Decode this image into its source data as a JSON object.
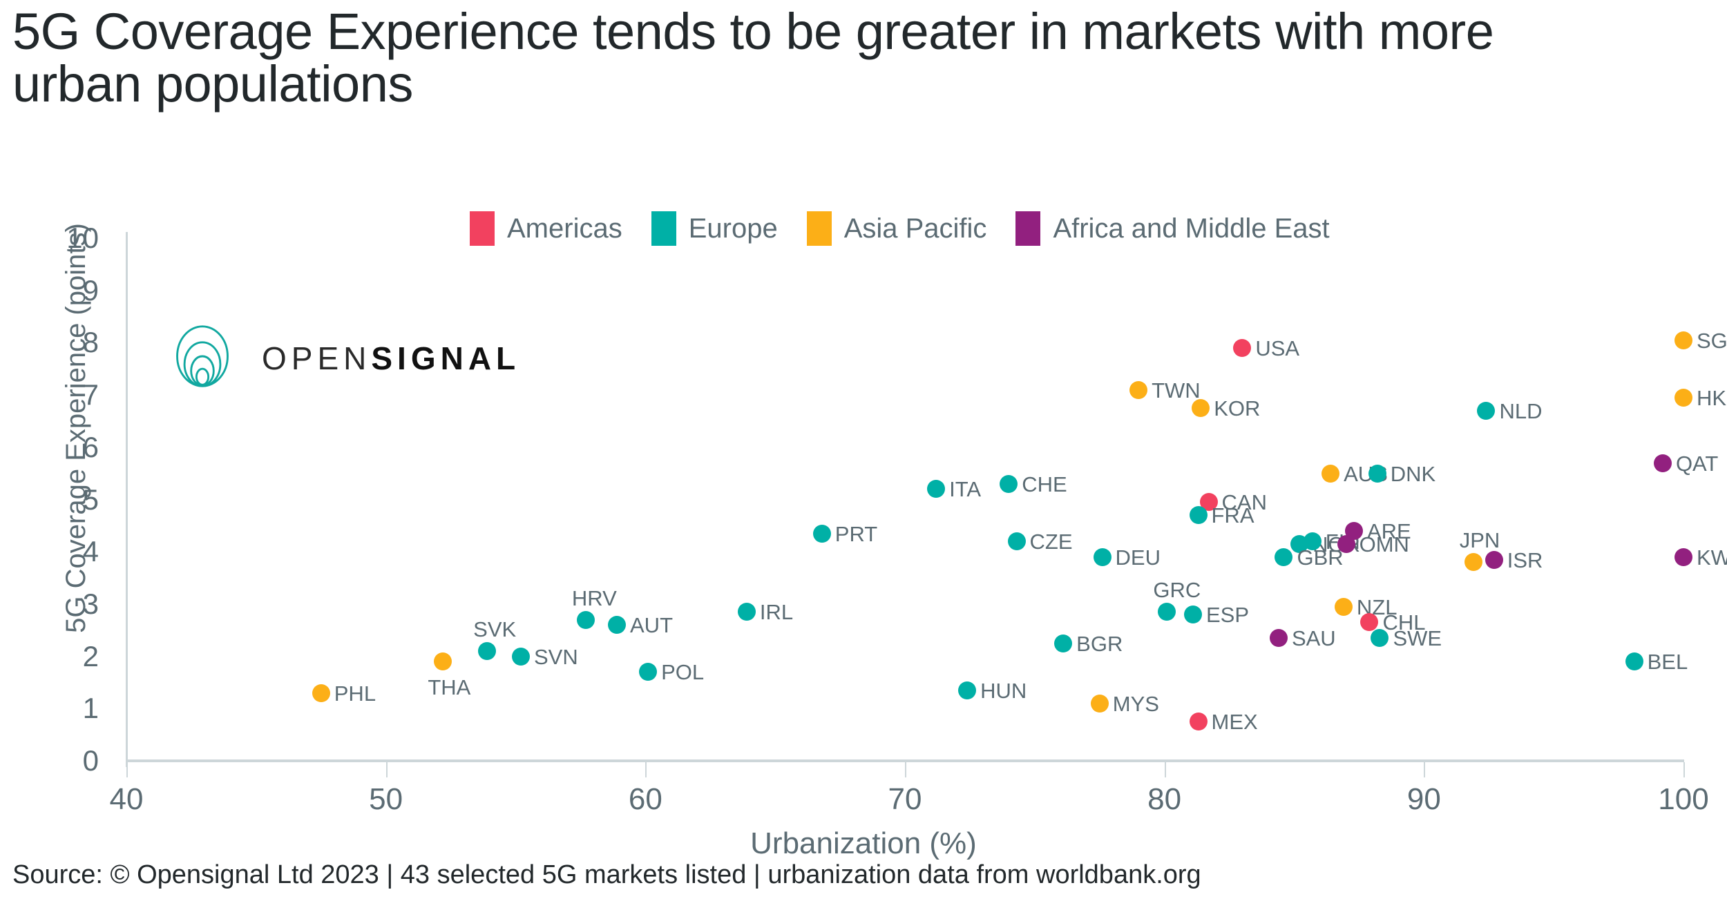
{
  "title": "5G Coverage Experience tends to be greater in markets with more urban populations",
  "source": "Source: © Opensignal Ltd 2023 | 43 selected 5G markets listed | urbanization data from worldbank.org",
  "logo": {
    "mark": "concentric-rings-icon",
    "text_light": "OPEN",
    "text_bold": "SIGNAL",
    "mark_color": "#11A8A0"
  },
  "chart_data": {
    "type": "scatter",
    "title": "5G Coverage Experience tends to be greater in markets with more urban populations",
    "xlabel": "Urbanization (%)",
    "ylabel": "5G Coverage Experience (points)",
    "xlim": [
      40,
      100
    ],
    "ylim": [
      0,
      10
    ],
    "xticks": [
      "40",
      "50",
      "60",
      "70",
      "80",
      "90",
      "100"
    ],
    "yticks": [
      "0",
      "1",
      "2",
      "3",
      "4",
      "5",
      "6",
      "7",
      "8",
      "9",
      "10"
    ],
    "grid": false,
    "legend_position": "top-center",
    "legend": [
      {
        "name": "Americas",
        "color": "#F2415F"
      },
      {
        "name": "Europe",
        "color": "#00B0A6"
      },
      {
        "name": "Asia Pacific",
        "color": "#FCAF17"
      },
      {
        "name": "Africa and Middle East",
        "color": "#92207F"
      }
    ],
    "points": [
      {
        "label": "PHL",
        "x": 47.5,
        "y": 1.3,
        "series": "Asia Pacific",
        "lp": "right"
      },
      {
        "label": "THA",
        "x": 52.2,
        "y": 1.9,
        "series": "Asia Pacific",
        "lp": "below"
      },
      {
        "label": "SVK",
        "x": 53.9,
        "y": 2.1,
        "series": "Europe",
        "lp": "above"
      },
      {
        "label": "SVN",
        "x": 55.2,
        "y": 2.0,
        "series": "Europe",
        "lp": "right"
      },
      {
        "label": "HRV",
        "x": 57.7,
        "y": 2.7,
        "series": "Europe",
        "lp": "above"
      },
      {
        "label": "AUT",
        "x": 58.9,
        "y": 2.6,
        "series": "Europe",
        "lp": "right"
      },
      {
        "label": "POL",
        "x": 60.1,
        "y": 1.7,
        "series": "Europe",
        "lp": "right"
      },
      {
        "label": "IRL",
        "x": 63.9,
        "y": 2.85,
        "series": "Europe",
        "lp": "right"
      },
      {
        "label": "PRT",
        "x": 66.8,
        "y": 4.35,
        "series": "Europe",
        "lp": "right"
      },
      {
        "label": "ITA",
        "x": 71.2,
        "y": 5.2,
        "series": "Europe",
        "lp": "right"
      },
      {
        "label": "HUN",
        "x": 72.4,
        "y": 1.35,
        "series": "Europe",
        "lp": "right"
      },
      {
        "label": "CHE",
        "x": 74.0,
        "y": 5.3,
        "series": "Europe",
        "lp": "right"
      },
      {
        "label": "CZE",
        "x": 74.3,
        "y": 4.2,
        "series": "Europe",
        "lp": "right"
      },
      {
        "label": "BGR",
        "x": 76.1,
        "y": 2.25,
        "series": "Europe",
        "lp": "right"
      },
      {
        "label": "DEU",
        "x": 77.6,
        "y": 3.9,
        "series": "Europe",
        "lp": "right"
      },
      {
        "label": "MYS",
        "x": 77.5,
        "y": 1.1,
        "series": "Asia Pacific",
        "lp": "right"
      },
      {
        "label": "TWN",
        "x": 79.0,
        "y": 7.1,
        "series": "Asia Pacific",
        "lp": "right"
      },
      {
        "label": "GRC",
        "x": 80.1,
        "y": 2.85,
        "series": "Europe",
        "lp": "above"
      },
      {
        "label": "ESP",
        "x": 81.1,
        "y": 2.8,
        "series": "Europe",
        "lp": "right"
      },
      {
        "label": "KOR",
        "x": 81.4,
        "y": 6.75,
        "series": "Asia Pacific",
        "lp": "right"
      },
      {
        "label": "MEX",
        "x": 81.3,
        "y": 0.75,
        "series": "Americas",
        "lp": "right"
      },
      {
        "label": "CAN",
        "x": 81.7,
        "y": 4.95,
        "series": "Americas",
        "lp": "right"
      },
      {
        "label": "FRA",
        "x": 81.3,
        "y": 4.7,
        "series": "Europe",
        "lp": "right"
      },
      {
        "label": "USA",
        "x": 83.0,
        "y": 7.9,
        "series": "Americas",
        "lp": "right"
      },
      {
        "label": "SAU",
        "x": 84.4,
        "y": 2.35,
        "series": "Africa and Middle East",
        "lp": "right"
      },
      {
        "label": "NOR",
        "x": 85.2,
        "y": 4.15,
        "series": "Europe",
        "lp": "right"
      },
      {
        "label": "GBR",
        "x": 84.6,
        "y": 3.9,
        "series": "Europe",
        "lp": "right"
      },
      {
        "label": "AUS",
        "x": 86.4,
        "y": 5.5,
        "series": "Asia Pacific",
        "lp": "right"
      },
      {
        "label": "FIN",
        "x": 85.7,
        "y": 4.2,
        "series": "Europe",
        "lp": "right"
      },
      {
        "label": "NZL",
        "x": 86.9,
        "y": 2.95,
        "series": "Asia Pacific",
        "lp": "right"
      },
      {
        "label": "ARE",
        "x": 87.3,
        "y": 4.4,
        "series": "Africa and Middle East",
        "lp": "right"
      },
      {
        "label": "OMN",
        "x": 87.0,
        "y": 4.15,
        "series": "Africa and Middle East",
        "lp": "right"
      },
      {
        "label": "CHL",
        "x": 87.9,
        "y": 2.65,
        "series": "Americas",
        "lp": "right"
      },
      {
        "label": "DNK",
        "x": 88.2,
        "y": 5.5,
        "series": "Europe",
        "lp": "right"
      },
      {
        "label": "SWE",
        "x": 88.3,
        "y": 2.35,
        "series": "Europe",
        "lp": "right"
      },
      {
        "label": "JPN",
        "x": 91.9,
        "y": 3.8,
        "series": "Asia Pacific",
        "lp": "above"
      },
      {
        "label": "NLD",
        "x": 92.4,
        "y": 6.7,
        "series": "Europe",
        "lp": "right"
      },
      {
        "label": "ISR",
        "x": 92.7,
        "y": 3.85,
        "series": "Africa and Middle East",
        "lp": "right"
      },
      {
        "label": "BEL",
        "x": 98.1,
        "y": 1.9,
        "series": "Europe",
        "lp": "right"
      },
      {
        "label": "QAT",
        "x": 99.2,
        "y": 5.7,
        "series": "Africa and Middle East",
        "lp": "right"
      },
      {
        "label": "KWT",
        "x": 100.0,
        "y": 3.9,
        "series": "Africa and Middle East",
        "lp": "right"
      },
      {
        "label": "HKG",
        "x": 100.0,
        "y": 6.95,
        "series": "Asia Pacific",
        "lp": "right"
      },
      {
        "label": "SGP",
        "x": 100.0,
        "y": 8.05,
        "series": "Asia Pacific",
        "lp": "right"
      }
    ]
  }
}
